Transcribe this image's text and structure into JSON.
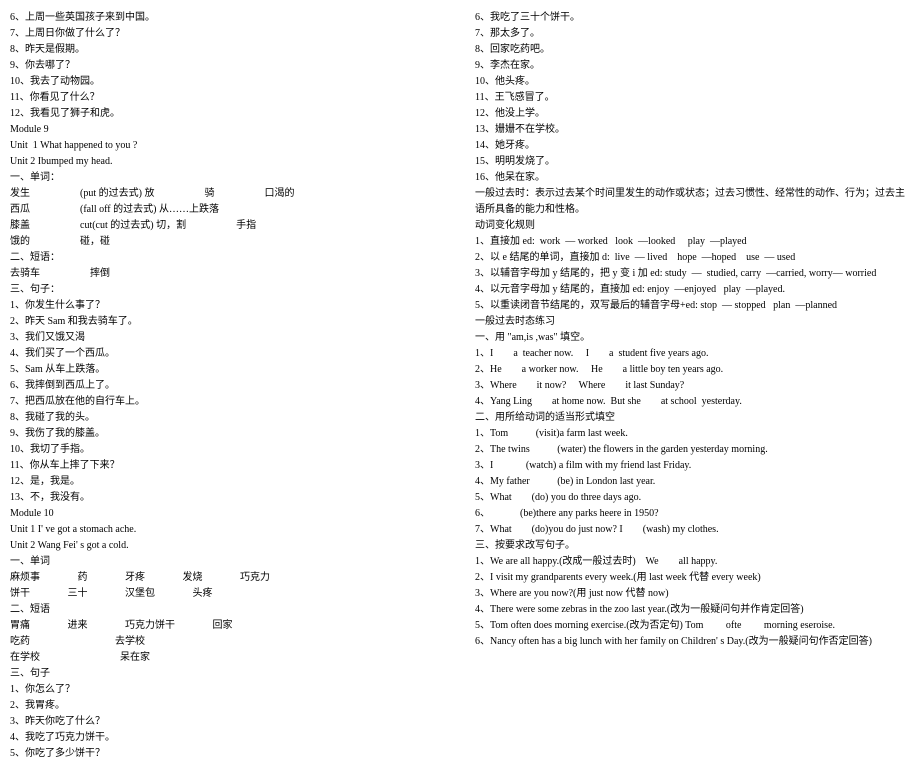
{
  "left": [
    "6、上周一些英国孩子来到中国。",
    "7、上周日你做了什么了？",
    "8、昨天是假期。",
    "9、你去哪了？",
    "10、我去了动物园。",
    "11、你看见了什么？",
    "12、我看见了狮子和虎。",
    "Module 9",
    "Unit  1 What happened to you ?",
    "Unit 2 Ibumped my head.",
    "一、单词：",
    "发生                    (put 的过去式) 放                    骑                    口渴的",
    "西瓜                    (fall off 的过去式) 从……上跌落",
    "膝盖                    cut(cut 的过去式) 切，割                    手指",
    "饿的                    碰，碰",
    "二、短语：",
    "去骑车                    摔倒",
    "三、句子：",
    "1、你发生什么事了？",
    "2、昨天 Sam 和我去骑车了。",
    "3、我们又饿又渴",
    "4、我们买了一个西瓜。",
    "5、Sam 从车上跌落。",
    "6、我摔倒到西瓜上了。",
    "7、把西瓜放在他的自行车上。",
    "8、我碰了我的头。",
    "9、我伤了我的膝盖。",
    "10、我切了手指。",
    "11、你从车上摔了下来？",
    "12、是，我是。",
    "13、不，我没有。",
    "Module 10",
    "Unit 1 I' ve got a stomach ache.",
    "Unit 2 Wang Fei' s got a cold.",
    "一、单词",
    "麻烦事               药               牙疼               发烧               巧克力",
    "饼干               三十               汉堡包               头疼",
    "二、短语",
    "胃痛               进来               巧克力饼干               回家",
    "吃药                                  去学校",
    "在学校                                呆在家",
    "三、句子",
    "1、你怎么了？",
    "2、我胃疼。",
    "3、昨天你吃了什么？",
    "4、我吃了巧克力饼干。",
    "5、你吃了多少饼干？"
  ],
  "right": [
    "6、我吃了三十个饼干。",
    "7、那太多了。",
    "8、回家吃药吧。",
    "9、李杰在家。",
    "10、他头疼。",
    "11、王飞感冒了。",
    "12、他没上学。",
    "13、姗姗不在学校。",
    "14、她牙疼。",
    "15、明明发烧了。",
    "16、他呆在家。",
    "",
    "一般过去时：表示过去某个时间里发生的动作或状态；过去习惯性、经常性的动作、行为；过去主语所具备的能力和性格。",
    "动词变化规则",
    "1、直接加 ed:  work  ― worked   look  ―looked     play  ―played",
    "2、以 e 结尾的单词，直接加 d:  live  ― lived    hope  ―hoped    use  ― used",
    "3、以辅音字母加 y 结尾的，把 y 变 i 加 ed: study  ―  studied, carry  ―carried, worry― worried",
    "4、以元音字母加 y 结尾的，直接加 ed: enjoy  ―enjoyed   play  ―played.",
    "5、以重读闭音节结尾的，双写最后的辅音字母+ed: stop  ― stopped   plan  ―planned",
    "",
    "一般过去时态练习",
    "一、用 \"am,is ,was\" 填空。",
    "1、I        a  teacher now.     I        a  student five years ago.",
    "2、He        a worker now.     He        a little boy ten years ago.",
    "3、Where        it now?     Where        it last Sunday?",
    "4、Yang Ling        at home now.  But she        at school  yesterday.",
    "二、用所给动词的适当形式填空",
    "1、Tom           (visit)a farm last week.",
    "2、The twins           (water) the flowers in the garden yesterday morning.",
    "3、I             (watch) a film with my friend last Friday.",
    "4、My father           (be) in London last year.",
    "5、What        (do) you do three days ago.",
    "6、            (be)there any parks heere in 1950?",
    "7、What        (do)you do just now? I        (wash) my clothes.",
    "三、按要求改写句子。",
    "1、We are all happy.(改成一般过去时)    We        all happy.",
    "2、I visit my grandparents every week.(用 last week 代替 every week)",
    "",
    "3、Where are you now?(用 just now 代替 now)",
    "4、There were some zebras in the zoo last year.(改为一般疑问句并作肯定回答)",
    "",
    "5、Tom often does morning exercise.(改为否定句) Tom         ofte         morning eseroise.",
    "6、Nancy often has a big lunch with her family on Children' s Day.(改为一般疑问句作否定回答)"
  ]
}
